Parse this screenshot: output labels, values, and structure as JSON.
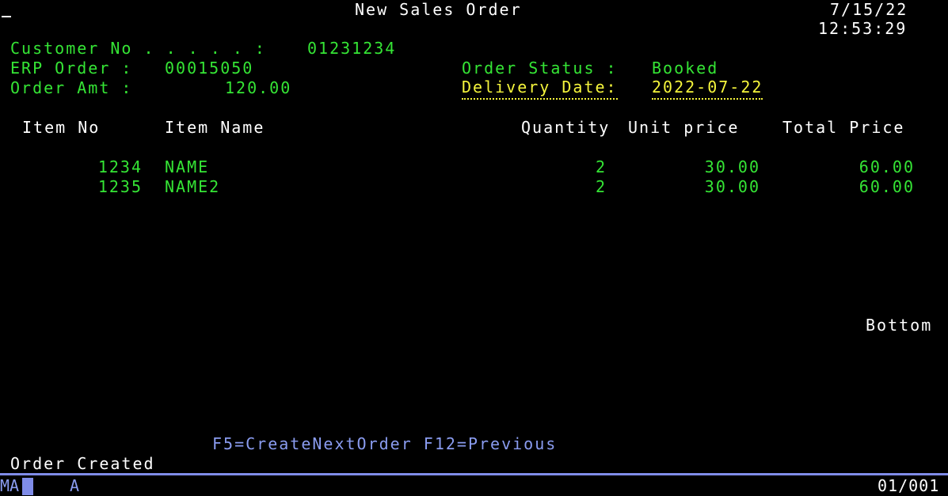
{
  "screen": {
    "title": "New Sales Order",
    "date": "7/15/22",
    "time": "12:53:29",
    "cursor_char": "_"
  },
  "header": {
    "customer_no_label": "Customer No . . . . . :",
    "customer_no": "01231234",
    "erp_order_label": "ERP Order :",
    "erp_order": "00015050",
    "order_amt_label": "Order Amt :",
    "order_amt": "120.00",
    "order_status_label": "Order Status :",
    "order_status": "Booked",
    "delivery_date_label": "Delivery Date:",
    "delivery_date": "2022-07-22"
  },
  "table": {
    "columns": {
      "item_no": "Item No",
      "item_name": "Item Name",
      "quantity": "Quantity",
      "unit_price": "Unit price",
      "total_price": "Total Price"
    },
    "rows": [
      {
        "item_no": "1234",
        "item_name": "NAME",
        "quantity": "2",
        "unit_price": "30.00",
        "total_price": "60.00"
      },
      {
        "item_no": "1235",
        "item_name": "NAME2",
        "quantity": "2",
        "unit_price": "30.00",
        "total_price": "60.00"
      }
    ],
    "more_indicator": "Bottom"
  },
  "function_keys": "F5=CreateNextOrder F12=Previous",
  "message": "Order Created",
  "status_bar": {
    "session": "MA",
    "mode": "A",
    "position": "01/001"
  },
  "colors": {
    "field": "#35e535",
    "highlight": "#f5f53c",
    "fkeys": "#8a9cf0",
    "text": "#ffffff"
  }
}
